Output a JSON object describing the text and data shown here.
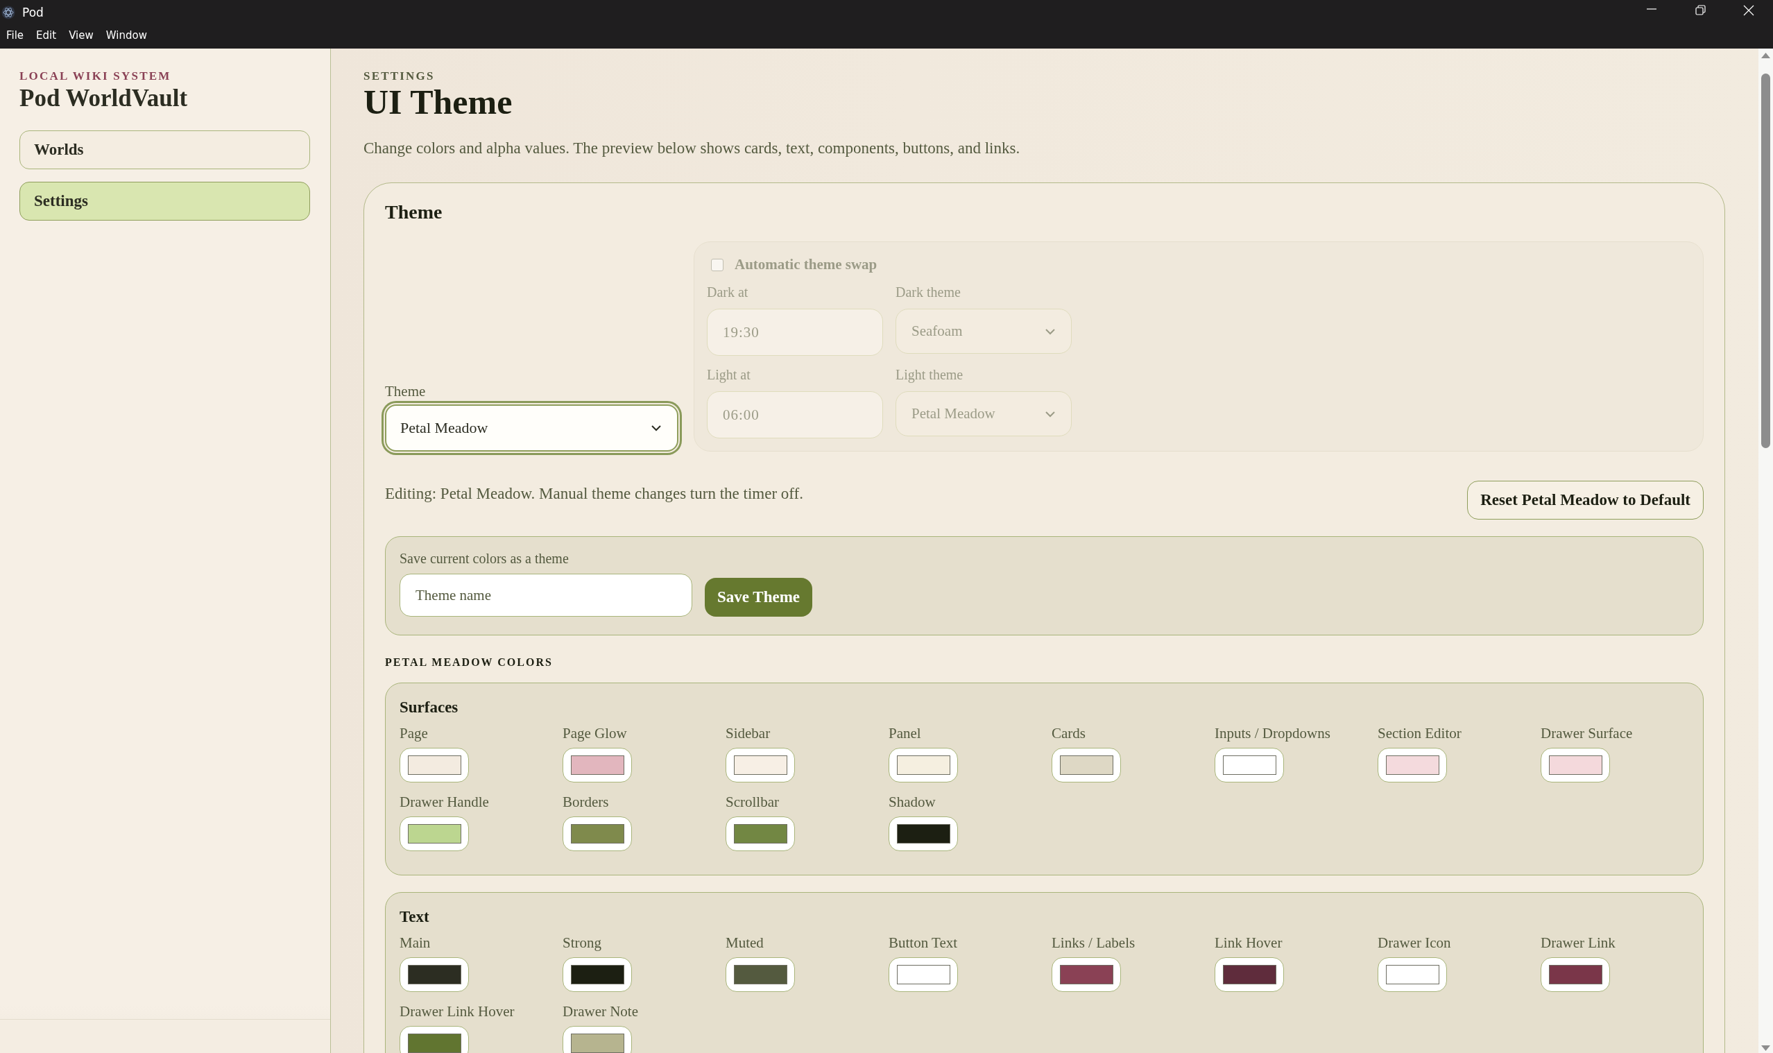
{
  "window": {
    "title": "Pod"
  },
  "menu": [
    "File",
    "Edit",
    "View",
    "Window"
  ],
  "sidebar": {
    "eyebrow": "LOCAL WIKI SYSTEM",
    "title": "Pod WorldVault",
    "items": [
      {
        "label": "Worlds",
        "selected": false
      },
      {
        "label": "Settings",
        "selected": true
      }
    ]
  },
  "page": {
    "eyebrow": "SETTINGS",
    "title": "UI Theme",
    "description": "Change colors and alpha values. The preview below shows cards, text, components, buttons, and links."
  },
  "theme_card": {
    "title": "Theme",
    "theme_select": {
      "label": "Theme",
      "value": "Petal Meadow",
      "focused": true
    },
    "auto_swap": {
      "label": "Automatic theme swap",
      "checked": false,
      "disabled": true,
      "fields": [
        {
          "kind": "time",
          "label": "Dark at",
          "value": "19:30"
        },
        {
          "kind": "select",
          "label": "Dark theme",
          "value": "Seafoam"
        },
        {
          "kind": "time",
          "label": "Light at",
          "value": "06:00"
        },
        {
          "kind": "select",
          "label": "Light theme",
          "value": "Petal Meadow"
        }
      ]
    },
    "editing_note": "Editing: Petal Meadow. Manual theme changes turn the timer off.",
    "reset_button": "Reset Petal Meadow to Default",
    "save": {
      "label": "Save current colors as a theme",
      "placeholder": "Theme name",
      "button": "Save Theme"
    },
    "colors_heading": "PETAL MEADOW COLORS",
    "groups": [
      {
        "title": "Surfaces",
        "colors": [
          {
            "label": "Page",
            "color": "#f3ebe0"
          },
          {
            "label": "Page Glow",
            "color": "#e2b6be"
          },
          {
            "label": "Sidebar",
            "color": "#f7efe5"
          },
          {
            "label": "Panel",
            "color": "#f5efe0"
          },
          {
            "label": "Cards",
            "color": "#ded8c5"
          },
          {
            "label": "Inputs / Dropdowns",
            "color": "#ffffff"
          },
          {
            "label": "Section Editor",
            "color": "#f4dadd"
          },
          {
            "label": "Drawer Surface",
            "color": "#f4d9dc"
          },
          {
            "label": "Drawer Handle",
            "color": "#bcd690"
          },
          {
            "label": "Borders",
            "color": "#7f8a4c"
          },
          {
            "label": "Scrollbar",
            "color": "#728743"
          },
          {
            "label": "Shadow",
            "color": "#1c1f12"
          }
        ]
      },
      {
        "title": "Text",
        "colors": [
          {
            "label": "Main",
            "color": "#2c2d22"
          },
          {
            "label": "Strong",
            "color": "#1c1f12"
          },
          {
            "label": "Muted",
            "color": "#545a3f"
          },
          {
            "label": "Button Text",
            "color": "#ffffff"
          },
          {
            "label": "Links / Labels",
            "color": "#8a4155"
          },
          {
            "label": "Link Hover",
            "color": "#5f2c3c"
          },
          {
            "label": "Drawer Icon",
            "color": "#ffffff"
          },
          {
            "label": "Drawer Link",
            "color": "#7a3649"
          },
          {
            "label": "Drawer Link Hover",
            "color": "#617530"
          },
          {
            "label": "Drawer Note",
            "color": "#b6b48f"
          }
        ]
      }
    ]
  }
}
